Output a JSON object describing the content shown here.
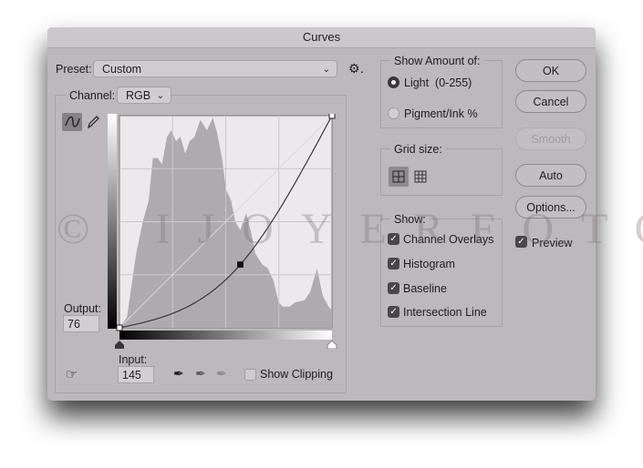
{
  "title": "Curves",
  "preset": {
    "label": "Preset:",
    "value": "Custom"
  },
  "channel": {
    "label": "Channel:",
    "value": "RGB"
  },
  "output": {
    "label": "Output:",
    "value": "76"
  },
  "input": {
    "label": "Input:",
    "value": "145"
  },
  "show_clipping": {
    "label": "Show Clipping",
    "checked": false
  },
  "show_amount": {
    "legend": "Show Amount of:",
    "options": [
      {
        "label": "Light  (0-255)",
        "selected": true
      },
      {
        "label": "Pigment/Ink %",
        "selected": false
      }
    ]
  },
  "grid_size": {
    "legend": "Grid size:",
    "selected": "simple"
  },
  "show": {
    "legend": "Show:",
    "items": [
      {
        "label": "Channel Overlays",
        "checked": true
      },
      {
        "label": "Histogram",
        "checked": true
      },
      {
        "label": "Baseline",
        "checked": true
      },
      {
        "label": "Intersection Line",
        "checked": true
      }
    ]
  },
  "buttons": {
    "ok": "OK",
    "cancel": "Cancel",
    "smooth": "Smooth",
    "auto": "Auto",
    "options": "Options..."
  },
  "preview": {
    "label": "Preview",
    "checked": true
  },
  "watermark": "© IJOYERFOTO",
  "curve": {
    "points": [
      [
        0,
        0
      ],
      [
        145,
        76
      ],
      [
        255,
        255
      ]
    ],
    "range": [
      0,
      255
    ]
  },
  "histogram": [
    [
      0,
      0
    ],
    [
      9,
      0.05
    ],
    [
      20,
      0.35
    ],
    [
      28,
      0.5
    ],
    [
      35,
      0.6
    ],
    [
      40,
      0.8
    ],
    [
      46,
      0.8
    ],
    [
      51,
      0.77
    ],
    [
      57,
      0.9
    ],
    [
      62,
      0.93
    ],
    [
      68,
      0.88
    ],
    [
      73,
      0.9
    ],
    [
      79,
      0.82
    ],
    [
      84,
      0.88
    ],
    [
      90,
      0.9
    ],
    [
      97,
      0.98
    ],
    [
      105,
      0.93
    ],
    [
      112,
      0.99
    ],
    [
      117,
      0.92
    ],
    [
      123,
      0.8
    ],
    [
      128,
      0.65
    ],
    [
      134,
      0.6
    ],
    [
      139,
      0.5
    ],
    [
      145,
      0.46
    ],
    [
      152,
      0.54
    ],
    [
      158,
      0.45
    ],
    [
      163,
      0.35
    ],
    [
      171,
      0.3
    ],
    [
      178,
      0.28
    ],
    [
      185,
      0.22
    ],
    [
      191,
      0.12
    ],
    [
      196,
      0.1
    ],
    [
      204,
      0.1
    ],
    [
      211,
      0.12
    ],
    [
      222,
      0.13
    ],
    [
      229,
      0.17
    ],
    [
      237,
      0.28
    ],
    [
      244,
      0.15
    ],
    [
      251,
      0.1
    ],
    [
      255,
      0.08
    ]
  ],
  "colors": {
    "dialog": "#bcb8bc",
    "graph_bg": "#ebe9ed",
    "histogram": "#aeabae"
  }
}
